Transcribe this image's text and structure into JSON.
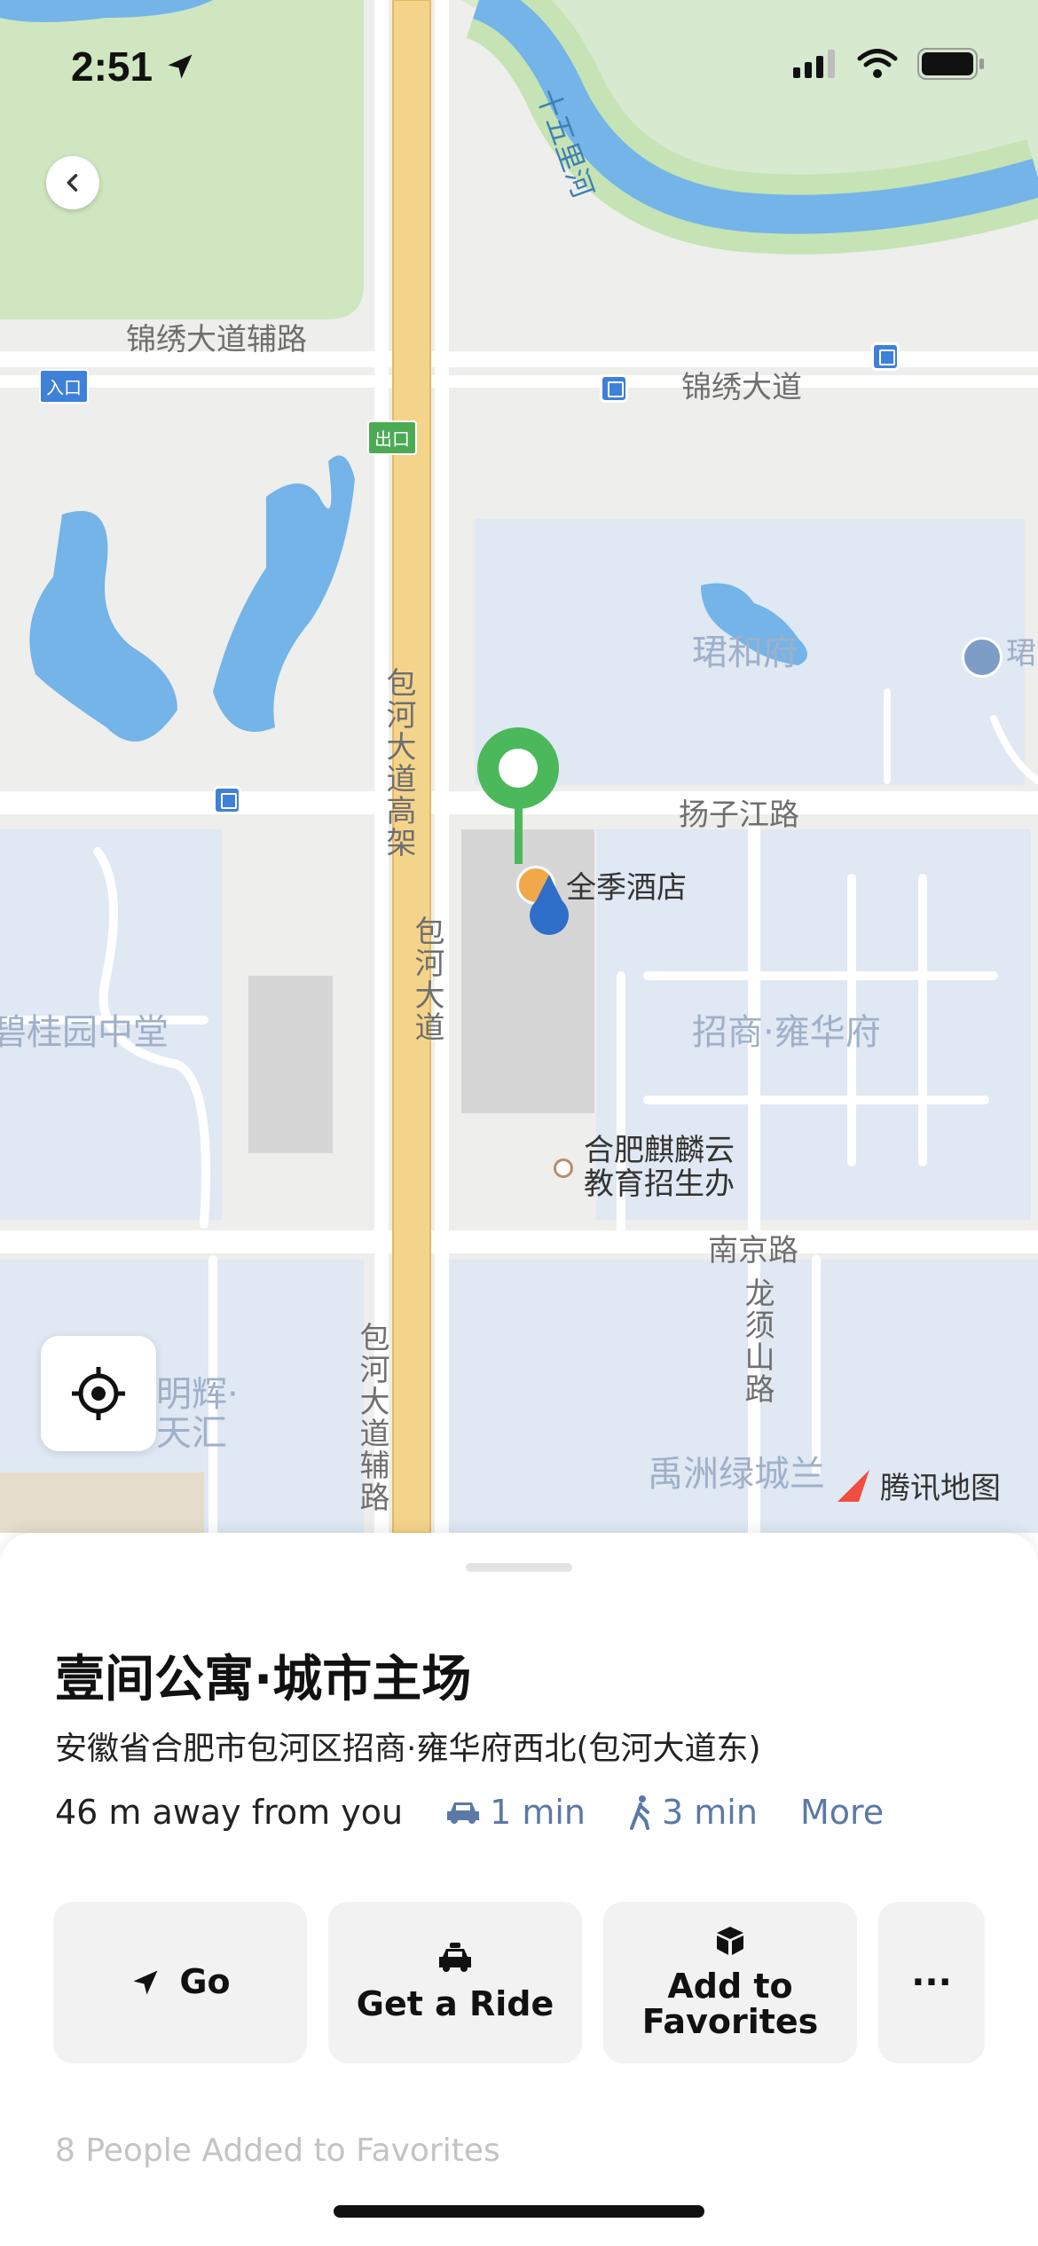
{
  "status_bar": {
    "time": "2:51"
  },
  "map": {
    "labels": {
      "road_jinxiu_aux": "锦绣大道辅路",
      "road_jinxiu": "锦绣大道",
      "river": "十五里河",
      "road_baohe_elevated": "包河大道高架",
      "road_baohe": "包河大道",
      "road_baohe_aux": "包河大道辅路",
      "road_yangzijiang": "扬子江路",
      "road_nanjing": "南京路",
      "road_longxushan": "龙须山路",
      "area_junhefu": "珺和府",
      "area_junhefu_edge": "珺",
      "area_zhaoshang": "招商·雍华府",
      "area_biguiyuan": "碧桂园中堂",
      "area_yuzhou": "禹洲绿城兰",
      "area_minghui_1": "明辉·",
      "area_minghui_2": "天汇",
      "poi_hotel": "全季酒店",
      "poi_school_1": "合肥麒麟云",
      "poi_school_2": "教育招生办",
      "entrance": "入口",
      "exit": "出口",
      "watermark": "腾讯地图"
    }
  },
  "place": {
    "title": "壹间公寓·城市主场",
    "address": "安徽省合肥市包河区招商·雍华府西北(包河大道东)",
    "distance": "46 m away from you",
    "drive_time": "1 min",
    "walk_time": "3 min",
    "more": "More"
  },
  "actions": {
    "go": "Go",
    "ride": "Get a Ride",
    "fav_line1": "Add to",
    "fav_line2": "Favorites",
    "more": "···"
  },
  "favorites_count": "8 People Added to Favorites",
  "colors": {
    "link": "#5b79a6",
    "pin": "#4cb85c",
    "user_dot": "#2f6fc9",
    "water": "#74b4e8",
    "park": "#cfe6c0",
    "residential": "#dfe8f3",
    "highway": "#f4d48b"
  }
}
